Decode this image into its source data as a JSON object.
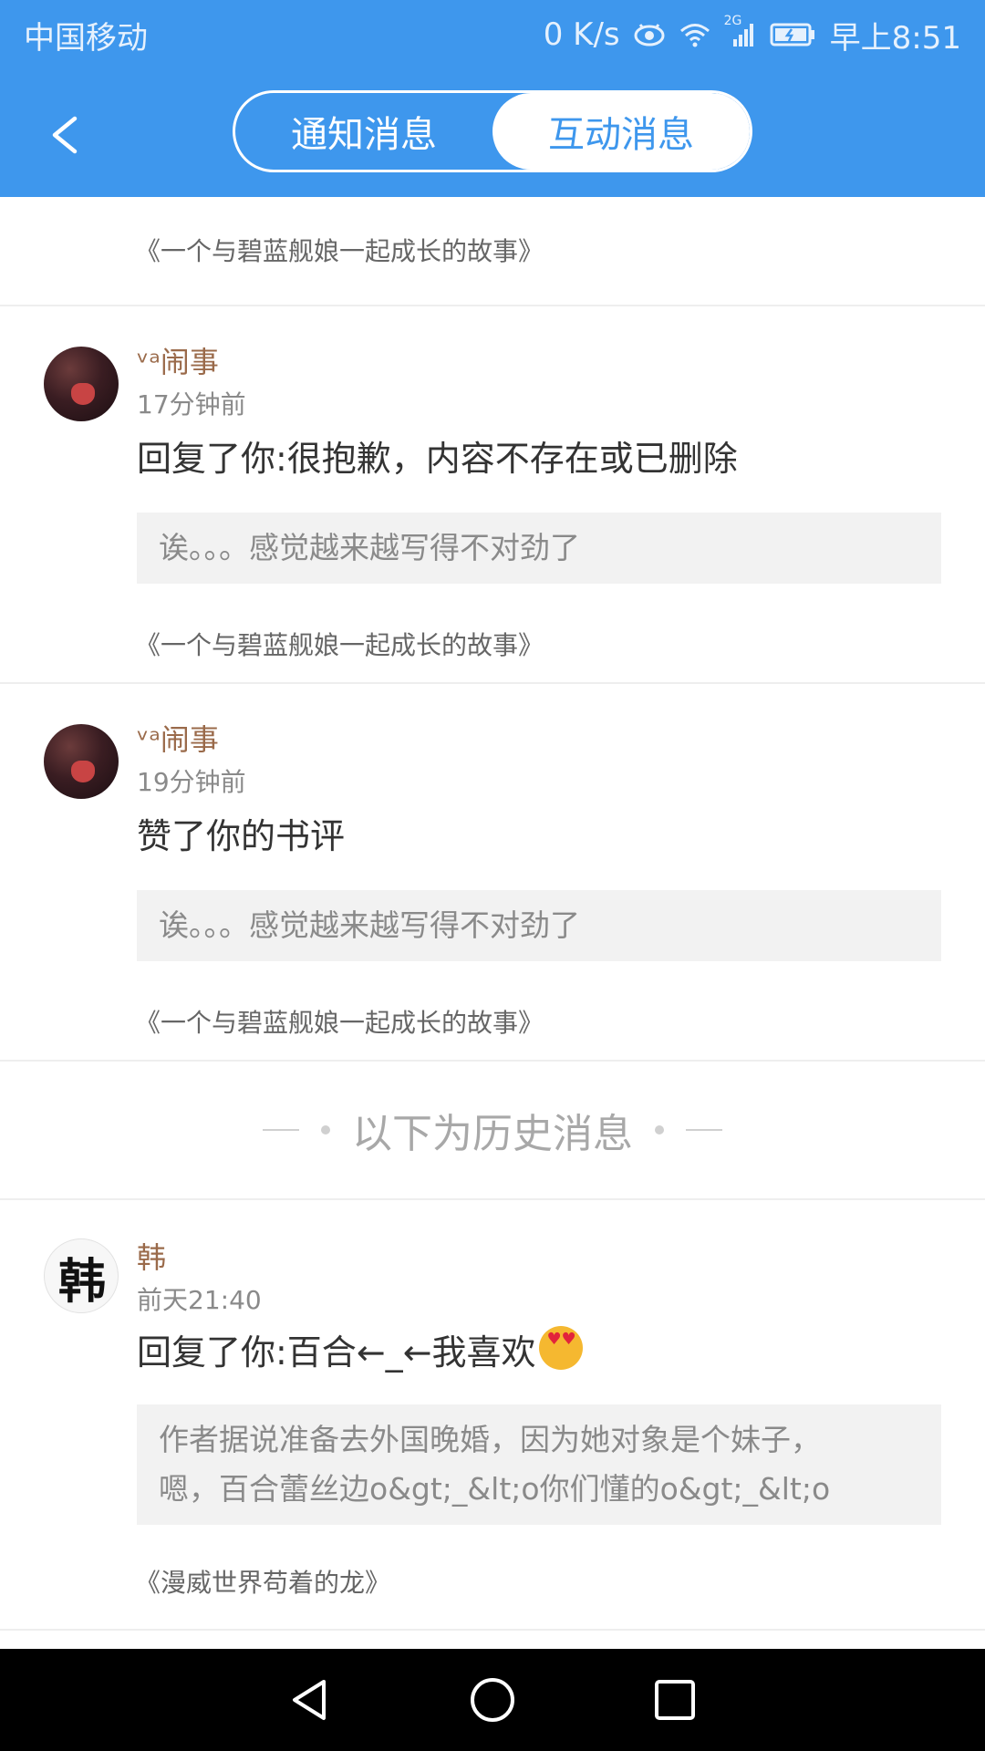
{
  "status_bar": {
    "carrier": "中国移动",
    "net_speed": "0 K/s",
    "network_type": "2G",
    "time": "早上8:51"
  },
  "header": {
    "tabs": [
      {
        "label": "通知消息",
        "active": false
      },
      {
        "label": "互动消息",
        "active": true
      }
    ]
  },
  "top_book": "《一个与碧蓝舰娘一起成长的故事》",
  "messages": [
    {
      "username": "ᵛᵃ闹事",
      "time": "17分钟前",
      "action": "回复了你:很抱歉，内容不存在或已删除",
      "quote": "诶。。。感觉越来越写得不对劲了",
      "book": "《一个与碧蓝舰娘一起成长的故事》"
    },
    {
      "username": "ᵛᵃ闹事",
      "time": "19分钟前",
      "action": "赞了你的书评",
      "quote": "诶。。。感觉越来越写得不对劲了",
      "book": "《一个与碧蓝舰娘一起成长的故事》"
    }
  ],
  "history_divider": "以下为历史消息",
  "history": [
    {
      "username": "韩",
      "avatar_glyph": "韩",
      "time": "前天21:40",
      "action": "回复了你:百合←_←我喜欢",
      "quote_line1": "作者据说准备去外国晚婚，因为她对象是个妹子，",
      "quote_line2": "嗯，百合蕾丝边o&gt;_&lt;o你们懂的o&gt;_&lt;o",
      "book": "《漫威世界苟着的龙》"
    }
  ],
  "colors": {
    "header": "#3e97ed",
    "username": "#9a6a4a",
    "quote_bg": "#f2f2f2"
  },
  "icons": [
    "back-icon",
    "eye-icon",
    "wifi-icon",
    "signal-icon",
    "battery-icon",
    "nav-back-icon",
    "nav-home-icon",
    "nav-recents-icon"
  ]
}
